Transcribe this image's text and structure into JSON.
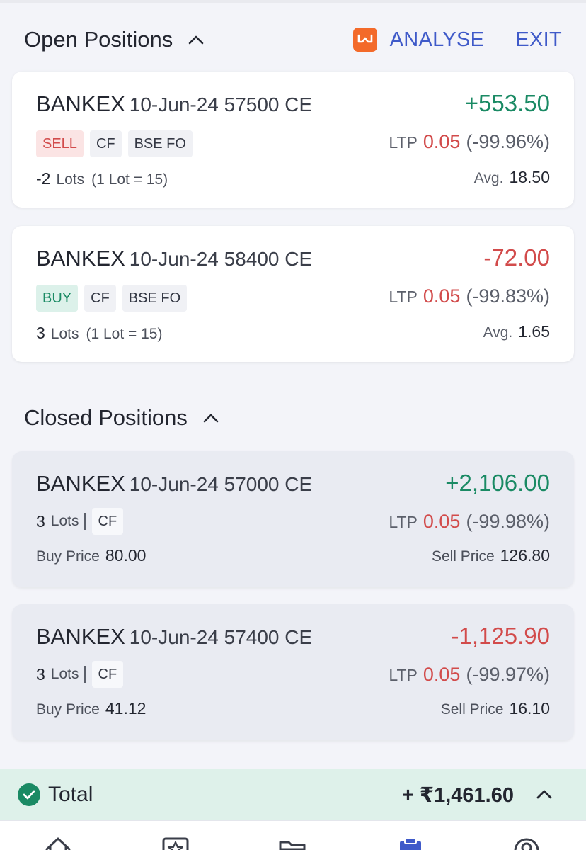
{
  "open_section": {
    "title": "Open Positions",
    "analyse_label": "ANALYSE",
    "exit_label": "EXIT",
    "positions": [
      {
        "symbol": "BANKEX",
        "contract": "10-Jun-24 57500 CE",
        "pnl": "+553.50",
        "side": "SELL",
        "product": "CF",
        "exchange": "BSE FO",
        "ltp_label": "LTP",
        "ltp": "0.05",
        "ltp_change": "(-99.96%)",
        "lots": "-2",
        "lots_label": "Lots",
        "lot_info": "(1 Lot = 15)",
        "avg_label": "Avg.",
        "avg": "18.50"
      },
      {
        "symbol": "BANKEX",
        "contract": "10-Jun-24 58400 CE",
        "pnl": "-72.00",
        "side": "BUY",
        "product": "CF",
        "exchange": "BSE FO",
        "ltp_label": "LTP",
        "ltp": "0.05",
        "ltp_change": "(-99.83%)",
        "lots": "3",
        "lots_label": "Lots",
        "lot_info": "(1 Lot = 15)",
        "avg_label": "Avg.",
        "avg": "1.65"
      }
    ]
  },
  "closed_section": {
    "title": "Closed Positions",
    "positions": [
      {
        "symbol": "BANKEX",
        "contract": "10-Jun-24 57000 CE",
        "pnl": "+2,106.00",
        "lots": "3",
        "lots_label": "Lots",
        "product": "CF",
        "ltp_label": "LTP",
        "ltp": "0.05",
        "ltp_change": "(-99.98%)",
        "buy_label": "Buy Price",
        "buy_price": "80.00",
        "sell_label": "Sell Price",
        "sell_price": "126.80"
      },
      {
        "symbol": "BANKEX",
        "contract": "10-Jun-24 57400 CE",
        "pnl": "-1,125.90",
        "lots": "3",
        "lots_label": "Lots",
        "product": "CF",
        "ltp_label": "LTP",
        "ltp": "0.05",
        "ltp_change": "(-99.97%)",
        "buy_label": "Buy Price",
        "buy_price": "41.12",
        "sell_label": "Sell Price",
        "sell_price": "16.10"
      }
    ]
  },
  "total": {
    "label": "Total",
    "value": "+ ₹1,461.60"
  },
  "bottom_nav": {
    "icons": [
      "home-icon",
      "watchlist-icon",
      "portfolio-icon",
      "orders-icon",
      "profile-icon"
    ],
    "active": "orders-icon"
  },
  "colors": {
    "profit": "#1a8a64",
    "loss": "#d24b4b",
    "accent": "#3f5ac9",
    "analyse_brand": "#f36a2a",
    "total_bar": "#def1ea"
  }
}
